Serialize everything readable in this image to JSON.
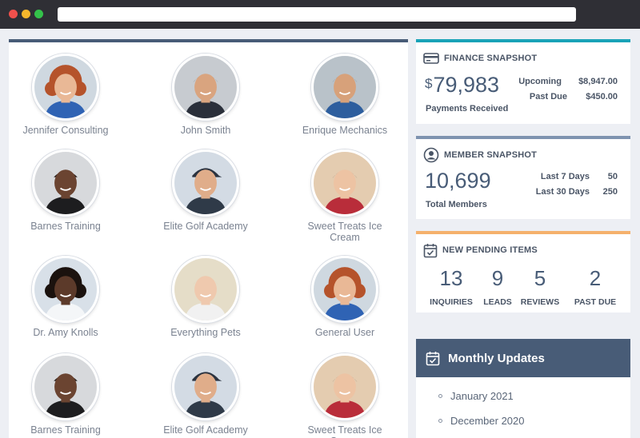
{
  "people": [
    {
      "name": "Jennifer Consulting",
      "avatar": "woman-curly-hair-avatar"
    },
    {
      "name": "John Smith",
      "avatar": "man-smiling-avatar"
    },
    {
      "name": "Enrique Mechanics",
      "avatar": "mechanic-avatar"
    },
    {
      "name": "Barnes Training",
      "avatar": "trainer-avatar"
    },
    {
      "name": "Elite Golf Academy",
      "avatar": "golfer-avatar"
    },
    {
      "name": "Sweet Treats Ice Cream",
      "avatar": "ice-cream-vendor-avatar"
    },
    {
      "name": "Dr. Amy Knolls",
      "avatar": "doctor-avatar"
    },
    {
      "name": "Everything Pets",
      "avatar": "pet-owner-avatar"
    },
    {
      "name": "General User",
      "avatar": "woman-curly-hair-avatar"
    },
    {
      "name": "Barnes Training",
      "avatar": "trainer-avatar"
    },
    {
      "name": "Elite Golf Academy",
      "avatar": "golfer-avatar"
    },
    {
      "name": "Sweet Treats Ice Cream",
      "avatar": "ice-cream-vendor-avatar"
    }
  ],
  "finance": {
    "title": "FINANCE SNAPSHOT",
    "currency": "$",
    "amount": "79,983",
    "amount_label": "Payments Received",
    "upcoming_label": "Upcoming",
    "upcoming_value": "$8,947.00",
    "pastdue_label": "Past Due",
    "pastdue_value": "$450.00"
  },
  "member": {
    "title": "MEMBER SNAPSHOT",
    "total": "10,699",
    "total_label": "Total Members",
    "last7_label": "Last 7 Days",
    "last7_value": "50",
    "last30_label": "Last 30 Days",
    "last30_value": "250"
  },
  "pending": {
    "title": "NEW PENDING ITEMS",
    "items": [
      {
        "count": "13",
        "label": "INQUIRIES"
      },
      {
        "count": "9",
        "label": "LEADS"
      },
      {
        "count": "5",
        "label": "REVIEWS"
      },
      {
        "count": "2",
        "label": "PAST DUE"
      }
    ]
  },
  "monthly": {
    "title": "Monthly Updates",
    "items": [
      "January 2021",
      "December 2020"
    ]
  },
  "colors": {
    "finance_accent": "#1aa3b8",
    "member_accent": "#7e93b0",
    "pending_accent": "#f5b16c",
    "header_navy": "#485c77"
  }
}
